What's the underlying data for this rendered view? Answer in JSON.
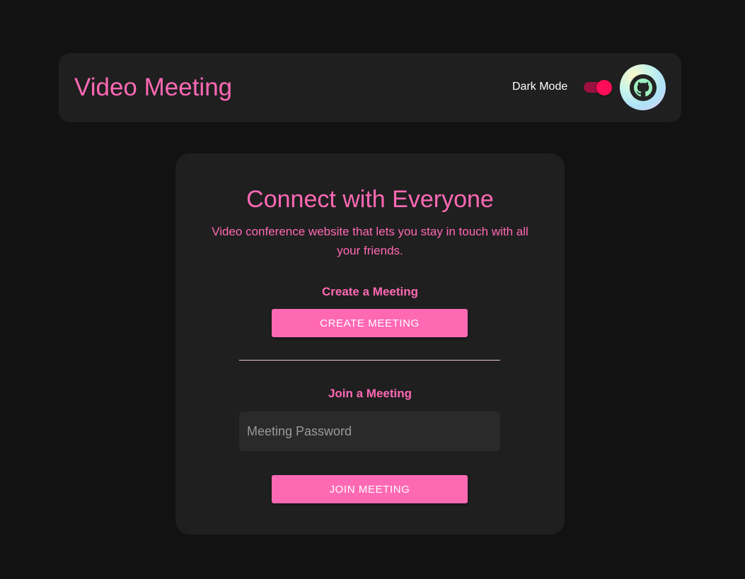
{
  "header": {
    "title": "Video Meeting",
    "dark_mode_label": "Dark Mode",
    "dark_mode_enabled": true,
    "github_icon": "github-icon"
  },
  "card": {
    "title": "Connect with Everyone",
    "subtitle": "Video conference website that lets you stay in touch with all your friends.",
    "create": {
      "label": "Create a Meeting",
      "button": "CREATE MEETING"
    },
    "join": {
      "label": "Join a Meeting",
      "password_placeholder": "Meeting Password",
      "password_value": "",
      "button": "JOIN MEETING"
    }
  },
  "colors": {
    "accent": "#ff69b4",
    "toggle_on": "#ff0d57",
    "background": "#121212",
    "surface": "#1f1f1f"
  }
}
